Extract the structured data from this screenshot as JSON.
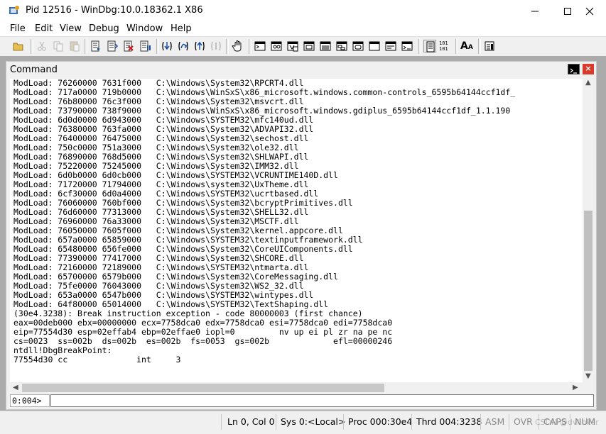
{
  "window": {
    "title": "Pid 12516 - WinDbg:10.0.18362.1 X86",
    "controls": {
      "minimize": "—",
      "maximize": "☐",
      "close": "✕"
    }
  },
  "menu": [
    "File",
    "Edit",
    "View",
    "Debug",
    "Window",
    "Help"
  ],
  "toolbar": {
    "buttons": [
      "open-icon",
      "cut-icon",
      "copy-icon",
      "paste-icon",
      "go-icon",
      "restart-icon",
      "stop-debugging-icon",
      "break-icon",
      "step-into-icon",
      "step-over-icon",
      "step-out-icon",
      "run-to-cursor-icon",
      "hand-icon",
      "command-window-icon",
      "watch-window-icon",
      "locals-window-icon",
      "registers-window-icon",
      "memory-window-icon",
      "call-stack-window-icon",
      "disassembly-window-icon",
      "scratch-pad-icon",
      "processes-threads-icon",
      "command-browser-icon",
      "source-mode-icon",
      "hex-mode-icon",
      "font-icon",
      "options-icon"
    ],
    "hex_mode_label": "101\n101",
    "font_label": "A"
  },
  "command_panel": {
    "title": "Command",
    "output_lines": [
      "ModLoad: 76260000 7631f000   C:\\Windows\\System32\\RPCRT4.dll",
      "ModLoad: 717a0000 719b0000   C:\\Windows\\WinSxS\\x86_microsoft.windows.common-controls_6595b64144ccf1df_",
      "ModLoad: 76b80000 76c3f000   C:\\Windows\\System32\\msvcrt.dll",
      "ModLoad: 73790000 738f9000   C:\\Windows\\WinSxS\\x86_microsoft.windows.gdiplus_6595b64144ccf1df_1.1.190",
      "ModLoad: 6d0d0000 6d943000   C:\\Windows\\SYSTEM32\\mfc140ud.dll",
      "ModLoad: 76380000 763fa000   C:\\Windows\\System32\\ADVAPI32.dll",
      "ModLoad: 76400000 76475000   C:\\Windows\\System32\\sechost.dll",
      "ModLoad: 750c0000 751a3000   C:\\Windows\\System32\\ole32.dll",
      "ModLoad: 76890000 768d5000   C:\\Windows\\System32\\SHLWAPI.dll",
      "ModLoad: 75220000 75245000   C:\\Windows\\System32\\IMM32.dll",
      "ModLoad: 6d0b0000 6d0cb000   C:\\Windows\\SYSTEM32\\VCRUNTIME140D.dll",
      "ModLoad: 71720000 71794000   C:\\Windows\\system32\\UxTheme.dll",
      "ModLoad: 6cf30000 6d0a4000   C:\\Windows\\SYSTEM32\\ucrtbased.dll",
      "ModLoad: 76060000 760bf000   C:\\Windows\\System32\\bcryptPrimitives.dll",
      "ModLoad: 76d60000 77313000   C:\\Windows\\System32\\SHELL32.dll",
      "ModLoad: 76960000 76a33000   C:\\Windows\\System32\\MSCTF.dll",
      "ModLoad: 76050000 7605f000   C:\\Windows\\System32\\kernel.appcore.dll",
      "ModLoad: 657a0000 65859000   C:\\Windows\\SYSTEM32\\textinputframework.dll",
      "ModLoad: 65480000 656fe000   C:\\Windows\\System32\\CoreUIComponents.dll",
      "ModLoad: 77390000 77417000   C:\\Windows\\System32\\SHCORE.dll",
      "ModLoad: 72160000 72189000   C:\\Windows\\SYSTEM32\\ntmarta.dll",
      "ModLoad: 65700000 6579b000   C:\\Windows\\System32\\CoreMessaging.dll",
      "ModLoad: 75fe0000 76043000   C:\\Windows\\System32\\WS2_32.dll",
      "ModLoad: 653a0000 6547b000   C:\\Windows\\SYSTEM32\\wintypes.dll",
      "ModLoad: 64f80000 65014000   C:\\Windows\\SYSTEM32\\TextShaping.dll",
      "(30e4.3238): Break instruction exception - code 80000003 (first chance)",
      "eax=00deb000 ebx=00000000 ecx=7758dca0 edx=7758dca0 esi=7758dca0 edi=7758dca0",
      "eip=77554d30 esp=02effab4 ebp=02effae0 iopl=0         nv up ei pl zr na pe nc",
      "cs=0023  ss=002b  ds=002b  es=002b  fs=0053  gs=002b             efl=00000246",
      "ntdll!DbgBreakPoint:",
      "77554d30 cc              int     3"
    ],
    "prompt": "0:004>",
    "input_value": ""
  },
  "statusbar": {
    "position": "Ln 0, Col 0",
    "system": "Sys 0:<Local>",
    "process": "Proc 000:30e4",
    "thread": "Thrd 004:3238",
    "asm": "ASM",
    "ovr": "OVR",
    "caps": "CAPS",
    "num": "NUM"
  },
  "watermark": "CSDN @dvlinker"
}
